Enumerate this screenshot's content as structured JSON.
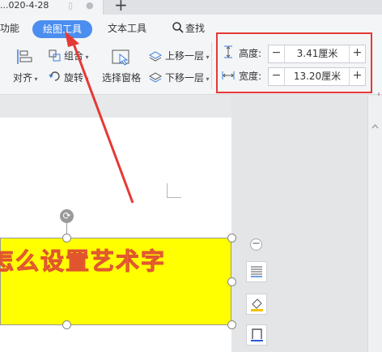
{
  "tabbar": {
    "doc_title": "...020-4-28",
    "new_tab": "+"
  },
  "menu": {
    "items": [
      {
        "label": "功能"
      },
      {
        "label": "绘图工具"
      },
      {
        "label": "文本工具"
      },
      {
        "label": "查找"
      }
    ]
  },
  "ribbon": {
    "group_label": "组合",
    "align_label": "对齐",
    "rotate_label": "旋转",
    "selection_pane_label": "选择窗格",
    "bring_forward_label": "上移一层",
    "send_backward_label": "下移一层"
  },
  "size": {
    "height_label": "高度:",
    "height_value": "3.41厘米",
    "width_label": "宽度:",
    "width_value": "13.20厘米",
    "minus": "−",
    "plus": "+"
  },
  "document": {
    "art_text": "怎么设置艺术字"
  },
  "colors": {
    "accent": "#4b8ef0",
    "highlight_box": "#e53935",
    "textbox_fill": "#ffff00",
    "art_fill": "#ff8c1a"
  }
}
